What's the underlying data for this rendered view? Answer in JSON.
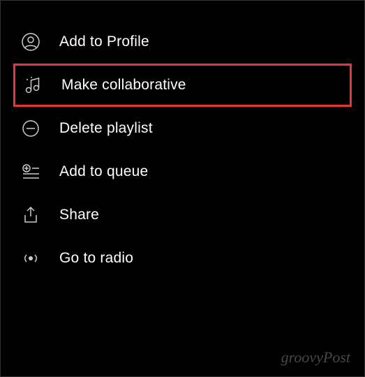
{
  "menu": {
    "items": [
      {
        "label": "Add to Profile",
        "icon": "profile-icon"
      },
      {
        "label": "Make collaborative",
        "icon": "music-note-icon",
        "highlighted": true
      },
      {
        "label": "Delete playlist",
        "icon": "minus-circle-icon"
      },
      {
        "label": "Add to queue",
        "icon": "queue-add-icon"
      },
      {
        "label": "Share",
        "icon": "share-icon"
      },
      {
        "label": "Go to radio",
        "icon": "radio-icon"
      }
    ]
  },
  "watermark": "groovyPost"
}
